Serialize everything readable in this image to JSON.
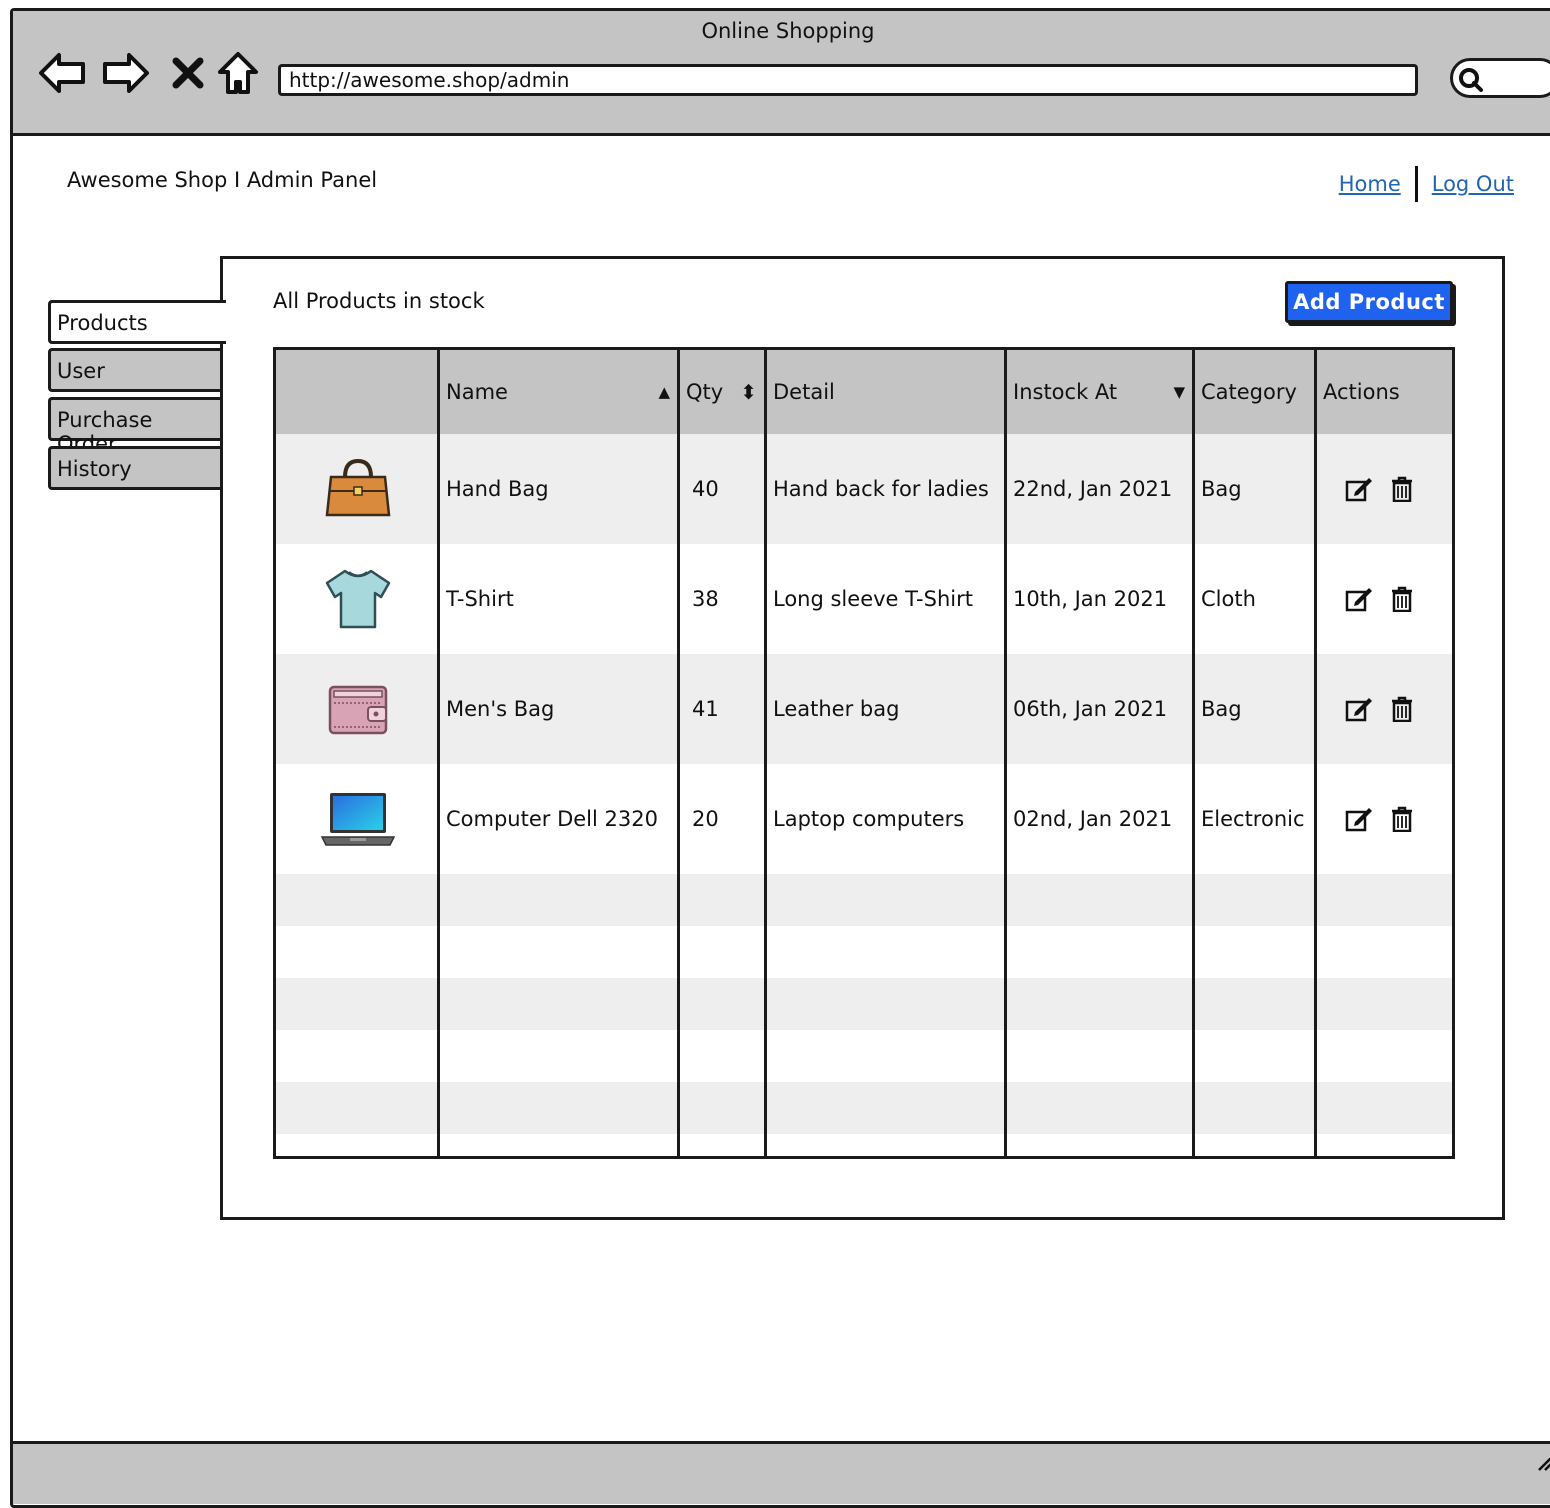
{
  "window": {
    "title": "Online Shopping"
  },
  "browser": {
    "url": "http://awesome.shop/admin",
    "icons": [
      "back-arrow-icon",
      "forward-arrow-icon",
      "close-x-icon",
      "home-icon",
      "search-icon"
    ]
  },
  "header": {
    "brand": "Awesome Shop I Admin Panel",
    "links": [
      {
        "label": "Home"
      },
      {
        "label": "Log Out"
      }
    ]
  },
  "sidebar": {
    "tabs": [
      {
        "label": "Products",
        "active": true
      },
      {
        "label": "User",
        "active": false
      },
      {
        "label": "Purchase Order",
        "active": false
      },
      {
        "label": "History",
        "active": false
      }
    ]
  },
  "main": {
    "title": "All Products in stock",
    "add_button": "Add Product"
  },
  "table": {
    "columns": [
      "",
      "Name",
      "Qty",
      "Detail",
      "Instock At",
      "Category",
      "Actions"
    ],
    "sort_icons": {
      "name": "▲",
      "qty": "⬍",
      "instock": "▼"
    },
    "rows": [
      {
        "icon": "handbag-icon",
        "name": "Hand Bag",
        "qty": "40",
        "detail": "Hand back for ladies",
        "instock": "22nd, Jan 2021",
        "category": "Bag"
      },
      {
        "icon": "tshirt-icon",
        "name": "T-Shirt",
        "qty": "38",
        "detail": "Long sleeve T-Shirt",
        "instock": "10th, Jan 2021",
        "category": "Cloth"
      },
      {
        "icon": "wallet-icon",
        "name": "Men's Bag",
        "qty": "41",
        "detail": "Leather bag",
        "instock": "06th, Jan 2021",
        "category": "Bag"
      },
      {
        "icon": "laptop-icon",
        "name": "Computer Dell 2320",
        "qty": "20",
        "detail": "Laptop computers",
        "instock": "02nd, Jan 2021",
        "category": "Electronic"
      }
    ],
    "action_icons": [
      "edit-icon",
      "trash-icon"
    ]
  },
  "colors": {
    "chrome": "#c4c4c4",
    "primary_button": "#1f62f0",
    "link": "#2364b3",
    "row_alt": "#eeeeee"
  }
}
